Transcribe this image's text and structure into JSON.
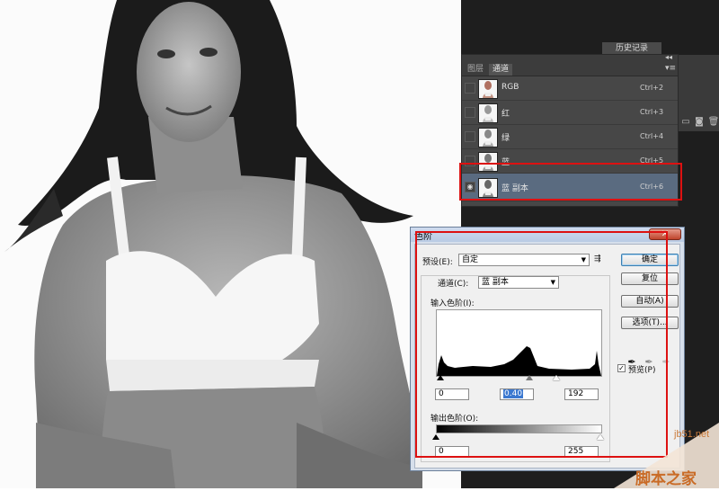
{
  "workspace": {
    "history_tab": "历史记录"
  },
  "channels_panel": {
    "tabs": [
      "图层",
      "通道"
    ],
    "channels": [
      {
        "name": "RGB",
        "shortcut": "Ctrl+2",
        "selected": false
      },
      {
        "name": "红",
        "shortcut": "Ctrl+3",
        "selected": false
      },
      {
        "name": "绿",
        "shortcut": "Ctrl+4",
        "selected": false
      },
      {
        "name": "蓝",
        "shortcut": "Ctrl+5",
        "selected": false
      },
      {
        "name": "蓝 副本",
        "shortcut": "Ctrl+6",
        "selected": true
      }
    ]
  },
  "levels_dialog": {
    "title": "色阶",
    "preset_label": "预设(E):",
    "preset_value": "自定",
    "channel_label": "通道(C):",
    "channel_value": "蓝 副本",
    "input_levels_label": "输入色阶(I):",
    "input_black": "0",
    "input_gamma": "0.40",
    "input_white": "192",
    "output_levels_label": "输出色阶(O):",
    "output_black": "0",
    "output_white": "255",
    "buttons": {
      "ok": "确定",
      "reset": "复位",
      "auto": "自动(A)",
      "options": "选项(T)..."
    },
    "preview_label": "预览(P)",
    "preview_checked": true
  },
  "watermark": {
    "url": "jb51.net",
    "name": "脚本之家"
  },
  "colors": {
    "highlight_box": "#dd1111",
    "selected_row": "#5a6b80",
    "dialog_frame": "#d6dfeb"
  }
}
